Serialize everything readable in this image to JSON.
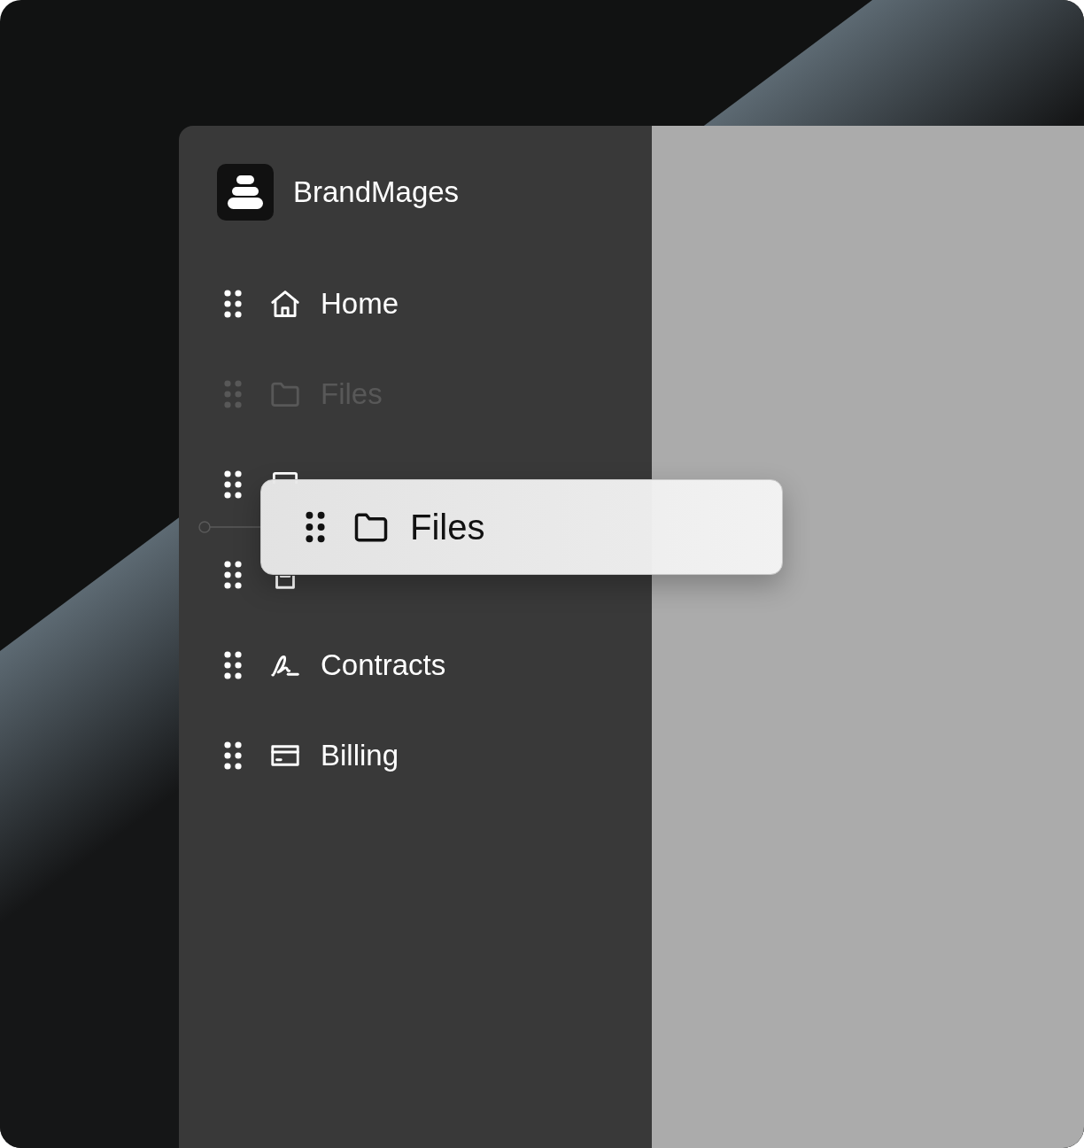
{
  "brand": {
    "name": "BrandMages"
  },
  "nav": {
    "items": [
      {
        "label": "Home",
        "dimmed": false
      },
      {
        "label": "Files",
        "dimmed": true
      },
      {
        "dimmed": false
      },
      {
        "dimmed": false
      },
      {
        "label": "Contracts",
        "dimmed": false
      },
      {
        "label": "Billing",
        "dimmed": false
      }
    ]
  },
  "drag_preview": {
    "label": "Files"
  }
}
